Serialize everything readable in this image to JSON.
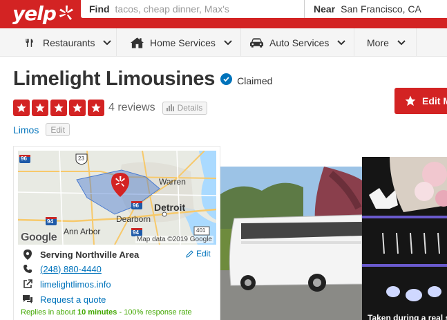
{
  "header": {
    "logo_text": "yelp",
    "find_label": "Find",
    "find_placeholder": "tacos, cheap dinner, Max's",
    "near_label": "Near",
    "near_value": "San Francisco, CA"
  },
  "nav": {
    "items": [
      {
        "label": "Restaurants",
        "icon": "fork-knife-icon"
      },
      {
        "label": "Home Services",
        "icon": "house-icon"
      },
      {
        "label": "Auto Services",
        "icon": "car-icon"
      },
      {
        "label": "More",
        "icon": ""
      }
    ]
  },
  "business": {
    "name": "Limelight Limousines",
    "claimed_label": "Claimed",
    "rating": 5,
    "reviews_label": "4 reviews",
    "details_label": "Details",
    "category": "Limos",
    "category_edit_label": "Edit",
    "edit_button_label": "Edit M"
  },
  "map": {
    "labels": {
      "warren": "Warren",
      "detroit": "Detroit",
      "dearborn": "Dearborn",
      "ann_arbor": "Ann Arbor",
      "shield_96": "96",
      "shield_23": "23",
      "shield_94": "94",
      "shield_401": "401"
    },
    "google_label": "Google",
    "attribution": "Map data ©2019 Google"
  },
  "info": {
    "serving": "Serving Northville Area",
    "edit_label": "Edit",
    "phone": "(248) 880-4440",
    "website": "limelightlimos.info",
    "quote_label": "Request a quote",
    "response_prefix": "Replies in about ",
    "response_time": "10 minutes",
    "response_rate": " - 100% response rate"
  },
  "photos": {
    "caption": "Taken during a real s"
  },
  "colors": {
    "brand_red": "#d32323",
    "link_blue": "#0073bb",
    "success_green": "#41a700"
  }
}
